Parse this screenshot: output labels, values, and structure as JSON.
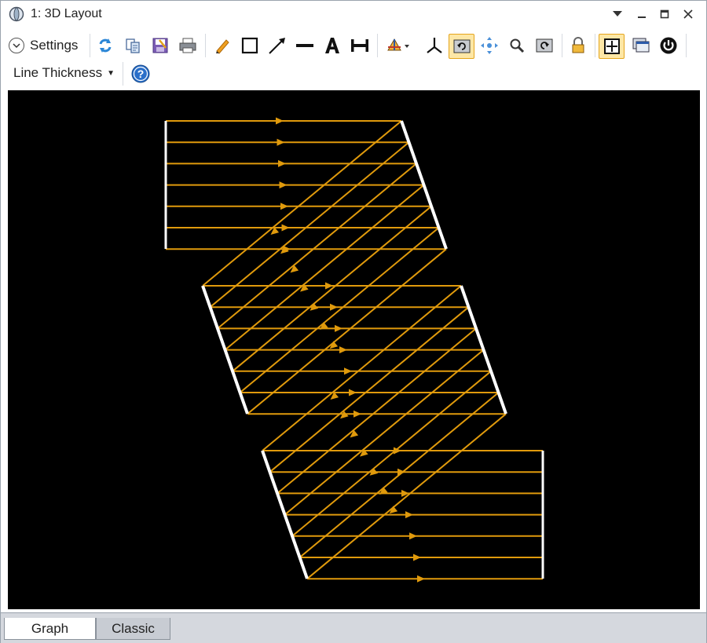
{
  "window": {
    "title": "1: 3D Layout"
  },
  "toolbar": {
    "settings_label": "Settings",
    "line_thickness_label": "Line Thickness",
    "icons": [
      "refresh-icon",
      "copy-icon",
      "save-icon",
      "print-icon",
      "pencil-icon",
      "rectangle-icon",
      "arrow-icon",
      "line-icon",
      "text-icon",
      "dimension-icon",
      "rotate-view-icon",
      "axis-icon",
      "rotate-active-icon",
      "pan-icon",
      "zoom-icon",
      "reset-view-icon",
      "lock-icon",
      "fit-window-icon",
      "window-layout-icon",
      "power-icon",
      "help-icon"
    ]
  },
  "tabs": [
    {
      "label": "Graph",
      "selected": true
    },
    {
      "label": "Classic",
      "selected": false
    }
  ],
  "colors": {
    "ray": "#e09a0c",
    "surface": "#ffffff",
    "background": "#000000",
    "active_button": "#fde7a6"
  }
}
